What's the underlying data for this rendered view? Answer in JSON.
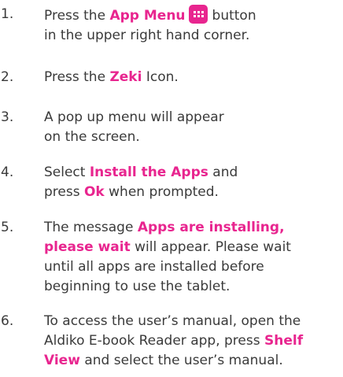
{
  "steps": [
    {
      "number": "1.",
      "line1_pre": "Press the ",
      "line1_hl": "App Menu",
      "line1_post": "button",
      "line2": "in the upper right hand corner."
    },
    {
      "number": "2.",
      "pre": "Press the ",
      "hl": "Zeki",
      "post": " Icon."
    },
    {
      "number": "3.",
      "line1": "A pop up menu will appear",
      "line2": "on the screen."
    },
    {
      "number": "4.",
      "line1_pre": "Select ",
      "line1_hl": "Install the Apps",
      "line1_post": " and",
      "line2_pre": "press ",
      "line2_hl": "Ok",
      "line2_post": " when prompted."
    },
    {
      "number": "5.",
      "line1_pre": "The message ",
      "line1_hl": "Apps are installing,",
      "line2_hl": "please wait",
      "line2_post": " will appear. Please wait",
      "line3": "until all apps are installed before",
      "line4": "beginning to use the tablet."
    },
    {
      "number": "6.",
      "line1": "To access the user’s manual, open the",
      "line2_pre": "Aldiko E-book Reader app, press ",
      "line2_hl": "Shelf",
      "line3_hl": "View",
      "line3_post": " and select the user’s manual."
    }
  ],
  "colors": {
    "highlight": "#e8258f",
    "text": "#3a3a3a"
  },
  "icons": {
    "app_menu": "app-menu-grid-icon"
  }
}
